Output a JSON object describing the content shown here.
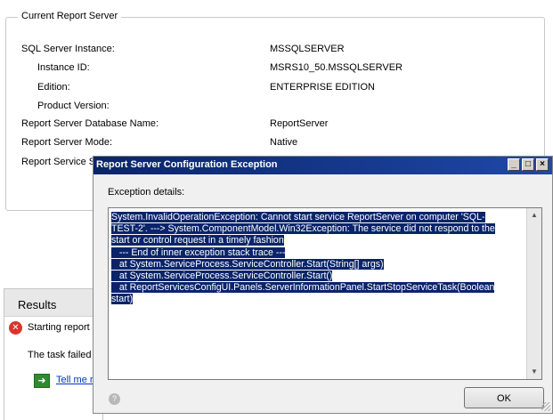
{
  "server_panel": {
    "title": "Current Report Server",
    "rows": [
      {
        "label": "SQL Server Instance:",
        "value": "MSSQLSERVER"
      },
      {
        "label": "Instance ID:",
        "value": "MSRS10_50.MSSQLSERVER"
      },
      {
        "label": "Edition:",
        "value": "ENTERPRISE EDITION"
      },
      {
        "label": "Product Version:",
        "value": ""
      },
      {
        "label": "Report Server Database Name:",
        "value": "ReportServer"
      },
      {
        "label": "Report Server Mode:",
        "value": "Native"
      },
      {
        "label": "Report Service S",
        "value": ""
      }
    ]
  },
  "results": {
    "title": "Results",
    "line1": "Starting report",
    "line2": "The task failed",
    "link": "Tell me r"
  },
  "dialog": {
    "title": "Report Server Configuration Exception",
    "details_label": "Exception details:",
    "details_lines": [
      "System.InvalidOperationException: Cannot start service ReportServer on computer 'SQL-",
      "TEST-2'. ---> System.ComponentModel.Win32Exception: The service did not respond to the",
      "start or control request in a timely fashion",
      "   --- End of inner exception stack trace ---",
      "   at System.ServiceProcess.ServiceController.Start(String[] args)",
      "   at System.ServiceProcess.ServiceController.Start()",
      "   at ReportServicesConfigUI.Panels.ServerInformationPanel.StartStopServiceTask(Boolean",
      "start)"
    ],
    "ok_label": "OK"
  },
  "icons": {
    "error": "error-icon",
    "help": "help-icon",
    "link": "arrow-right-icon"
  }
}
